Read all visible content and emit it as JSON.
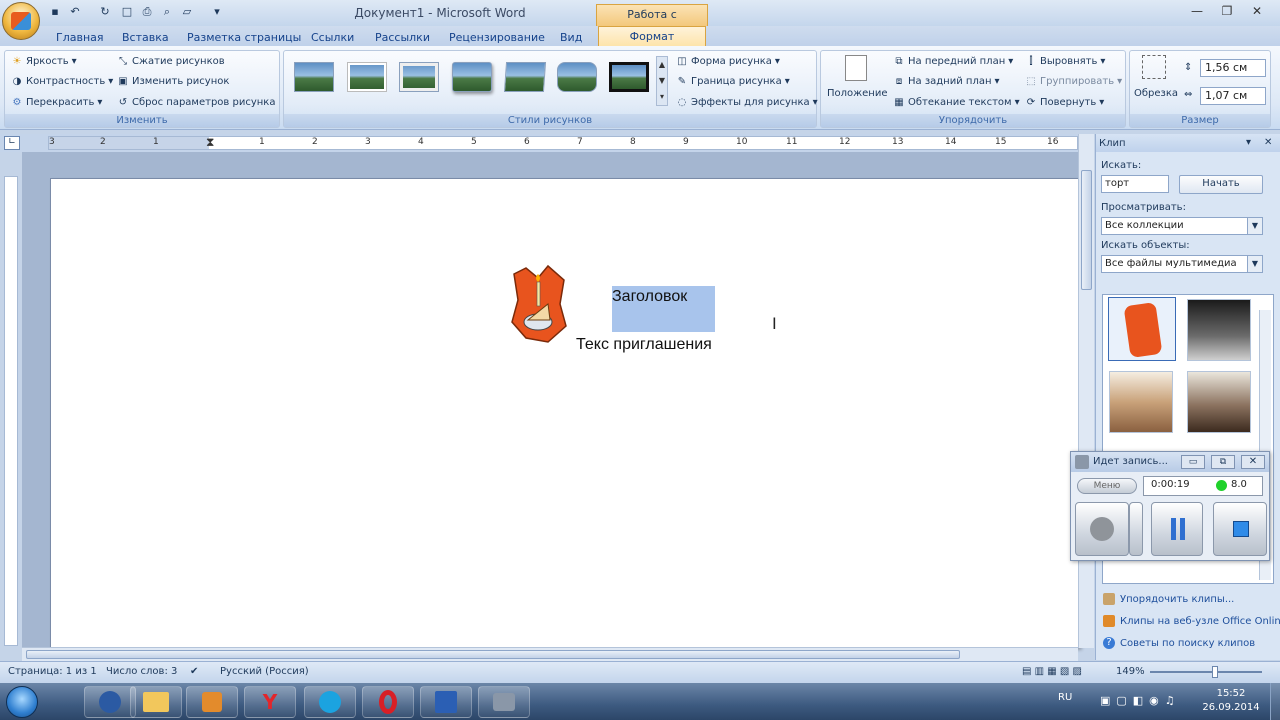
{
  "window": {
    "title": "Документ1 - Microsoft Word",
    "context_group": "Работа с рисунками"
  },
  "tabs": [
    "Главная",
    "Вставка",
    "Разметка страницы",
    "Ссылки",
    "Рассылки",
    "Рецензирование",
    "Вид",
    "Формат"
  ],
  "ribbon": {
    "adjust": {
      "label": "Изменить",
      "brightness": "Яркость",
      "contrast": "Контрастность",
      "recolor": "Перекрасить",
      "compress": "Сжатие рисунков",
      "change": "Изменить рисунок",
      "reset": "Сброс параметров рисунка"
    },
    "styles": {
      "label": "Стили рисунков",
      "shape": "Форма рисунка",
      "border": "Граница рисунка",
      "effects": "Эффекты для рисунка"
    },
    "arrange": {
      "label": "Упорядочить",
      "position": "Положение",
      "front": "На передний план",
      "back": "На задний план",
      "wrap": "Обтекание текстом",
      "align": "Выровнять",
      "group": "Группировать",
      "rotate": "Повернуть"
    },
    "size": {
      "label": "Размер",
      "crop": "Обрезка",
      "height": "1,56 см",
      "width": "1,07 см"
    }
  },
  "ruler": {
    "labels": [
      "3",
      "2",
      "1",
      "1",
      "2",
      "3",
      "4",
      "5",
      "6",
      "7",
      "8",
      "9",
      "10",
      "11",
      "12",
      "13",
      "14",
      "15",
      "16"
    ]
  },
  "document": {
    "heading": "Заголовок",
    "body": "Текс приглашения"
  },
  "pane": {
    "title": "Клип",
    "search_label": "Искать:",
    "search_value": "торт",
    "search_button": "Начать",
    "browse_label": "Просматривать:",
    "browse_value": "Все коллекции",
    "find_label": "Искать объекты:",
    "find_value": "Все файлы мультимедиа",
    "links": [
      "Упорядочить клипы...",
      "Клипы на веб-узле Office Online",
      "Советы по поиску клипов"
    ]
  },
  "recorder": {
    "title": "Идет запись...",
    "menu": "Меню",
    "time": "0:00:19",
    "level": "8.0"
  },
  "status": {
    "page": "Страница: 1 из 1",
    "words": "Число слов: 3",
    "language": "Русский (Россия)",
    "zoom": "149%"
  },
  "taskbar": {
    "lang": "RU",
    "time": "15:52",
    "date": "26.09.2014"
  }
}
